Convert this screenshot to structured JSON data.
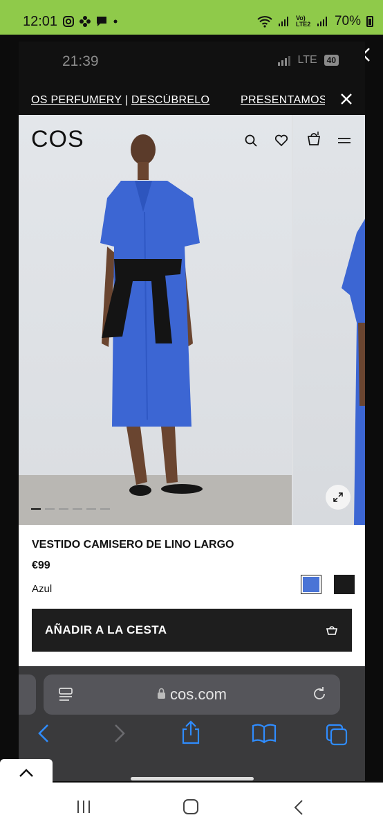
{
  "android_status": {
    "time": "12:01",
    "battery": "70%",
    "network": "Vo) LTE2"
  },
  "inner_status": {
    "time": "21:39",
    "network": "LTE",
    "badge": "40"
  },
  "promo": {
    "text_a": "OS PERFUMERY",
    "sep": " | ",
    "text_b": "DESCÚBRELO",
    "text_c": "PRESENTAMOS"
  },
  "header": {
    "logo": "COS"
  },
  "product": {
    "name": "VESTIDO CAMISERO DE LINO LARGO",
    "price": "€99",
    "color": "Azul",
    "swatches": [
      "#4a74d6",
      "#1a1a1a"
    ],
    "add_label": "AÑADIR A LA CESTA"
  },
  "gallery": {
    "image_count": 6,
    "current": 1
  },
  "safari": {
    "url": "cos.com"
  },
  "colors": {
    "status_bar": "#8fca4a",
    "dress": "#3c66d3",
    "safari_blue": "#2f8cff"
  }
}
